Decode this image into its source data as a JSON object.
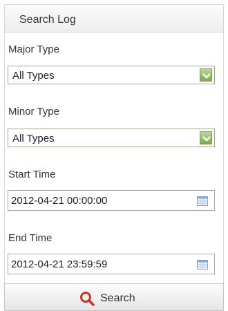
{
  "panel": {
    "title": "Search Log"
  },
  "major_type": {
    "label": "Major Type",
    "selected": "All Types"
  },
  "minor_type": {
    "label": "Minor Type",
    "selected": "All Types"
  },
  "start_time": {
    "label": "Start Time",
    "value": "2012-04-21 00:00:00"
  },
  "end_time": {
    "label": "End Time",
    "value": "2012-04-21 23:59:59"
  },
  "search_button": {
    "label": "Search"
  },
  "colors": {
    "dropdown_arrow": "#8cba5e",
    "search_icon": "#c8332b",
    "calendar_icon": "#7d9cc7"
  },
  "icons": {
    "dropdown": "chevron-down-icon",
    "calendar": "calendar-icon",
    "search": "search-icon"
  }
}
